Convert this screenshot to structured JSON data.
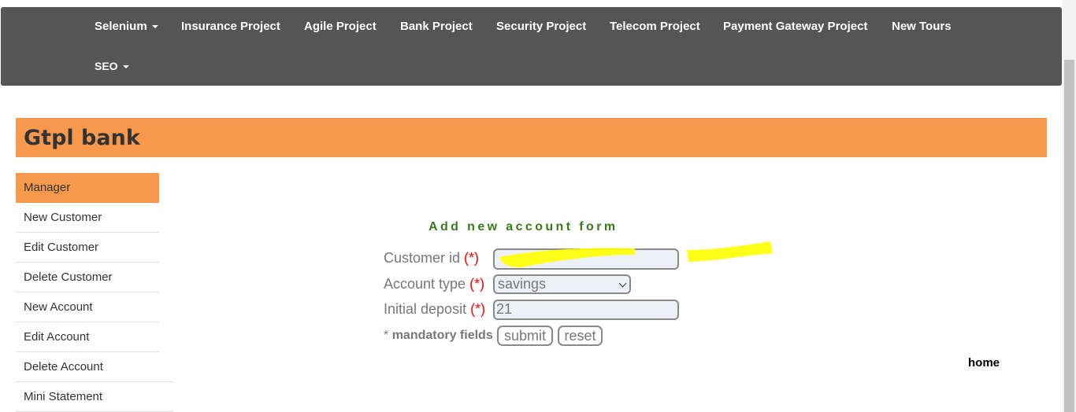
{
  "navbar": {
    "items": [
      {
        "label": "Selenium",
        "dropdown": true
      },
      {
        "label": "Insurance Project"
      },
      {
        "label": "Agile Project"
      },
      {
        "label": "Bank Project"
      },
      {
        "label": "Security Project"
      },
      {
        "label": "Telecom Project"
      },
      {
        "label": "Payment Gateway Project"
      },
      {
        "label": "New Tours"
      },
      {
        "label": "SEO",
        "dropdown": true
      }
    ],
    "background": "#555555"
  },
  "banner": {
    "title": "Gtpl bank",
    "color": "#f7994d"
  },
  "sidebar": {
    "items": [
      {
        "label": "Manager",
        "active": true
      },
      {
        "label": "New Customer"
      },
      {
        "label": "Edit Customer"
      },
      {
        "label": "Delete Customer"
      },
      {
        "label": "New Account"
      },
      {
        "label": "Edit Account"
      },
      {
        "label": "Delete Account"
      },
      {
        "label": "Mini Statement"
      }
    ]
  },
  "form": {
    "title": "Add new account form",
    "required_marker": "(*)",
    "customer_id": {
      "label": "Customer id",
      "value": ""
    },
    "account_type": {
      "label": "Account type",
      "value": "savings"
    },
    "initial_deposit": {
      "label": "Initial deposit",
      "value": "21"
    },
    "mandatory_prefix": "*",
    "mandatory_text": "mandatory fields",
    "submit_label": "submit",
    "reset_label": "reset"
  },
  "home_link": "home",
  "highlight_color": "#ffff00"
}
